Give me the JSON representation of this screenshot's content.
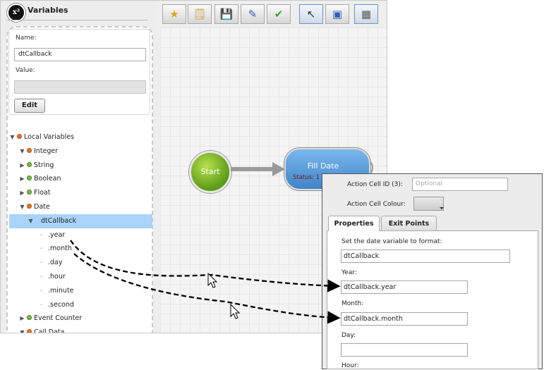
{
  "window": {
    "title": "Variables",
    "logo_text": "x²"
  },
  "form": {
    "name_label": "Name:",
    "name_value": "dtCallback",
    "value_label": "Value:",
    "value_value": "",
    "edit_button": "Edit"
  },
  "tree": {
    "items": [
      {
        "label": "Local Variables",
        "level": 0,
        "toggle": "▼",
        "dot": "orange"
      },
      {
        "label": "Integer",
        "level": 1,
        "toggle": "▼",
        "dot": "orange"
      },
      {
        "label": "String",
        "level": 1,
        "toggle": "▶",
        "dot": "green"
      },
      {
        "label": "Boolean",
        "level": 1,
        "toggle": "▶",
        "dot": "green"
      },
      {
        "label": "Float",
        "level": 1,
        "toggle": "▶",
        "dot": "green"
      },
      {
        "label": "Date",
        "level": 1,
        "toggle": "▼",
        "dot": "orange"
      },
      {
        "label": "dtCallback",
        "level": 2,
        "toggle": "▼",
        "dot": "",
        "selected": true
      },
      {
        "label": ".year",
        "level": 3,
        "toggle": "",
        "dot": ""
      },
      {
        "label": ".month",
        "level": 3,
        "toggle": "",
        "dot": ""
      },
      {
        "label": ".day",
        "level": 3,
        "toggle": "",
        "dot": ""
      },
      {
        "label": ".hour",
        "level": 3,
        "toggle": "",
        "dot": ""
      },
      {
        "label": ".minute",
        "level": 3,
        "toggle": "",
        "dot": ""
      },
      {
        "label": ".second",
        "level": 3,
        "toggle": "",
        "dot": ""
      },
      {
        "label": "Event Counter",
        "level": 1,
        "toggle": "▶",
        "dot": "green"
      },
      {
        "label": "Call Data",
        "level": 1,
        "toggle": "▼",
        "dot": "orange"
      }
    ]
  },
  "toolbar": {
    "buttons": [
      {
        "icon": "star-icon",
        "glyph": "★",
        "color": "#e0a516"
      },
      {
        "icon": "note-icon",
        "glyph": "🗒",
        "color": "#c9a43a"
      },
      {
        "icon": "save-icon",
        "glyph": "💾",
        "color": "#3a5aa6"
      },
      {
        "icon": "edit-icon",
        "glyph": "✎",
        "color": "#3a5aa6"
      },
      {
        "icon": "check-icon",
        "glyph": "✔",
        "color": "#32a832"
      },
      {
        "icon": "pointer-icon",
        "glyph": "↖",
        "color": "#223355",
        "selected": true
      },
      {
        "icon": "select-box-icon",
        "glyph": "▣",
        "color": "#2f5db8"
      },
      {
        "icon": "grid-icon",
        "glyph": "▦",
        "color": "#555555",
        "selected": true
      }
    ]
  },
  "canvas": {
    "start_label": "Start",
    "node_title": "Fill Date",
    "node_status": "Status: 1"
  },
  "props": {
    "action_cell_id_label": "Action Cell ID (3):",
    "action_cell_id_placeholder": "Optional",
    "action_cell_colour_label": "Action Cell Colour:",
    "tabs": [
      "Properties",
      "Exit Points"
    ],
    "set_date_label": "Set the date variable to format:",
    "date_var_value": "dtCallback",
    "year_label": "Year:",
    "year_value": "dtCallback.year",
    "month_label": "Month:",
    "month_value": "dtCallback.month",
    "day_label": "Day:",
    "day_value": "",
    "hour_label": "Hour:"
  },
  "colors": {
    "selection": "#a9d3f9",
    "start_node": "#7cbc2f",
    "node_blue": "#4a8fd3"
  }
}
